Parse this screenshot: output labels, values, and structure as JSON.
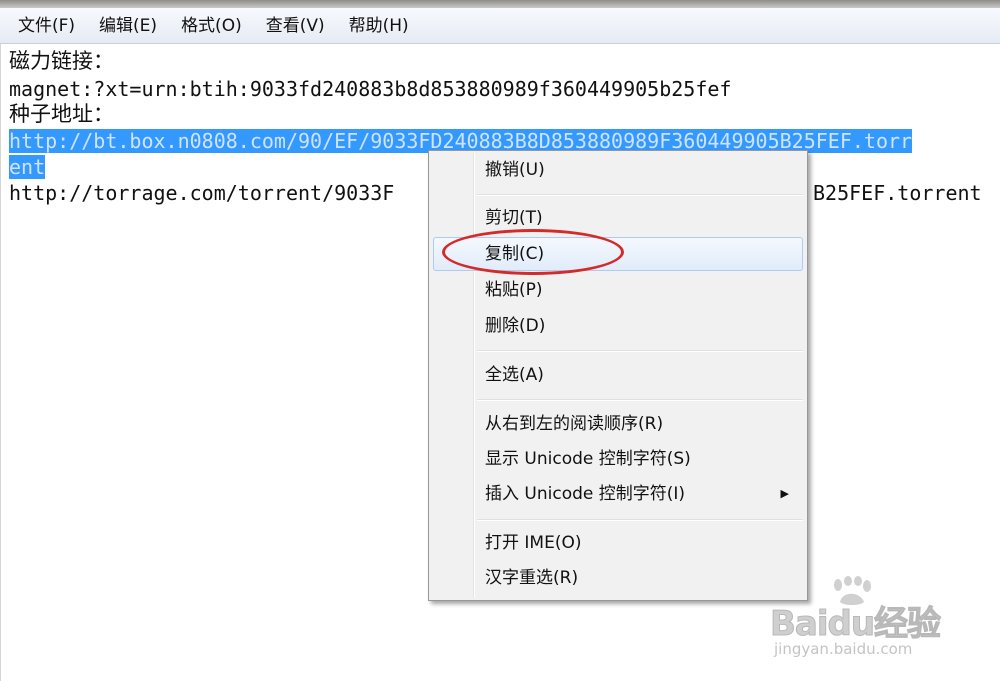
{
  "menubar": {
    "items": [
      "文件(F)",
      "编辑(E)",
      "格式(O)",
      "查看(V)",
      "帮助(H)"
    ]
  },
  "document": {
    "lines": [
      "磁力链接：",
      "magnet:?xt=urn:btih:9033fd240883b8d853880989f360449905b25fef",
      "种子地址：",
      "http://bt.box.n0808.com/90/EF/9033FD240883B8D853880989F360449905B25FEF.torr",
      "ent",
      "http://torrage.com/torrent/9033F",
      "B25FEF.torrent"
    ]
  },
  "context_menu": {
    "items": [
      "撤销(U)",
      "剪切(T)",
      "复制(C)",
      "粘贴(P)",
      "删除(D)",
      "全选(A)",
      "从右到左的阅读顺序(R)",
      "显示 Unicode 控制字符(S)",
      "插入 Unicode 控制字符(I)",
      "打开 IME(O)",
      "汉字重选(R)"
    ],
    "highlighted": "复制(C)",
    "submenu_arrow": "▶"
  },
  "watermark": {
    "logo": "Baidu经验",
    "url": "jingyan.baidu.com"
  },
  "colors": {
    "selection": "#3399ff",
    "annotation": "#d42a2a",
    "menu_background": "#f1f1f1"
  }
}
